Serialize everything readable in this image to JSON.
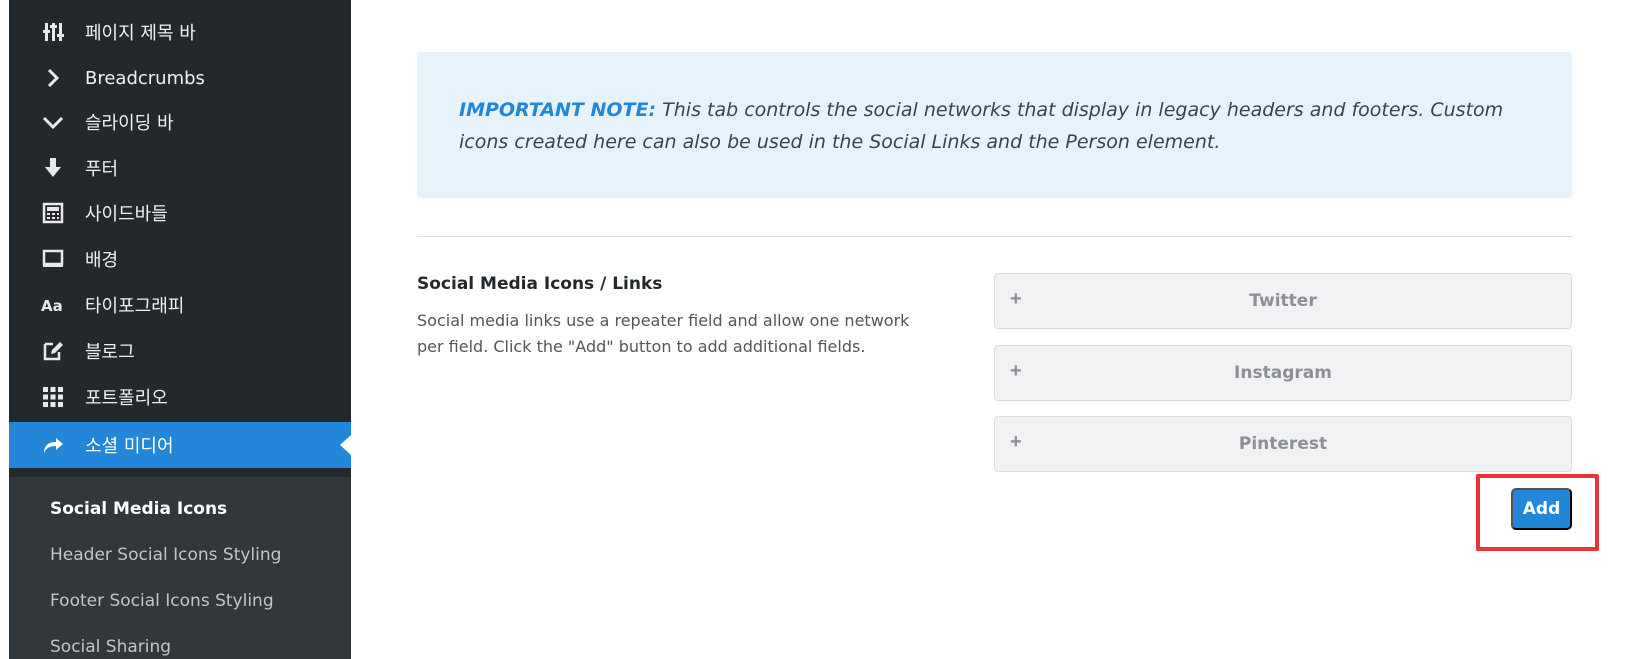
{
  "sidebar": {
    "items": [
      {
        "label": "페이지 제목 바",
        "icon": "sliders-icon"
      },
      {
        "label": "Breadcrumbs",
        "icon": "chevron-right-icon"
      },
      {
        "label": "슬라이딩 바",
        "icon": "chevron-down-icon"
      },
      {
        "label": "푸터",
        "icon": "arrow-down-icon"
      },
      {
        "label": "사이드바들",
        "icon": "sidebar-layout-icon"
      },
      {
        "label": "배경",
        "icon": "monitor-icon"
      },
      {
        "label": "타이포그래피",
        "icon": "typography-icon"
      },
      {
        "label": "블로그",
        "icon": "edit-icon"
      },
      {
        "label": "포트폴리오",
        "icon": "grid-icon"
      },
      {
        "label": "소셜 미디어",
        "icon": "share-icon"
      }
    ],
    "submenu": [
      "Social Media Icons",
      "Header Social Icons Styling",
      "Footer Social Icons Styling",
      "Social Sharing"
    ]
  },
  "note": {
    "label": "IMPORTANT NOTE:",
    "text": "This tab controls the social networks that display in legacy headers and footers. Custom icons created here can also be used in the Social Links and the Person element."
  },
  "section": {
    "title": "Social Media Icons / Links",
    "description": "Social media links use a repeater field and allow one network per field. Click the \"Add\" button to add additional fields."
  },
  "repeater": {
    "expand_glyph": "+",
    "rows": [
      "Twitter",
      "Instagram",
      "Pinterest"
    ],
    "add_label": "Add"
  },
  "colors": {
    "accent": "#2387d9",
    "highlight": "#e8333c",
    "sidebar_bg": "#23282d"
  }
}
